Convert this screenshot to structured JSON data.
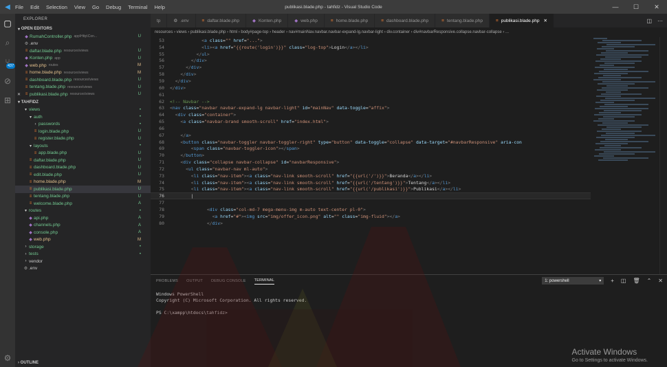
{
  "title_bar": {
    "menu": [
      "File",
      "Edit",
      "Selection",
      "View",
      "Go",
      "Debug",
      "Terminal",
      "Help"
    ],
    "window_title": "publikasi.blade.php - tahfidz - Visual Studio Code"
  },
  "activity_bar": {
    "scm_badge": "437"
  },
  "sidebar": {
    "title": "EXPLORER",
    "open_editors_label": "OPEN EDITORS",
    "open_editors": [
      {
        "name": "RumahController.php",
        "desc": "app\\Http\\Con...",
        "status": "U"
      },
      {
        "name": ".env",
        "desc": "",
        "status": ""
      },
      {
        "name": "daftar.blade.php",
        "desc": "resources\\views",
        "status": "U"
      },
      {
        "name": "Konten.php",
        "desc": "app",
        "status": "U"
      },
      {
        "name": "web.php",
        "desc": "routes",
        "status": "M"
      },
      {
        "name": "home.blade.php",
        "desc": "resources\\views",
        "status": "M"
      },
      {
        "name": "dashboard.blade.php",
        "desc": "resources\\views",
        "status": "U"
      },
      {
        "name": "tentang.blade.php",
        "desc": "resources\\views",
        "status": "U"
      },
      {
        "name": "publikasi.blade.php",
        "desc": "resources\\views",
        "status": "U"
      }
    ],
    "project_label": "TAHFIDZ",
    "tree": [
      {
        "name": "views",
        "indent": 1,
        "kind": "folder-open",
        "status": "•"
      },
      {
        "name": "auth",
        "indent": 2,
        "kind": "folder-open",
        "status": "•"
      },
      {
        "name": "passwords",
        "indent": 3,
        "kind": "folder",
        "status": "•"
      },
      {
        "name": "login.blade.php",
        "indent": 3,
        "kind": "file",
        "status": "U"
      },
      {
        "name": "register.blade.php",
        "indent": 3,
        "kind": "file",
        "status": "U"
      },
      {
        "name": "layouts",
        "indent": 2,
        "kind": "folder-open",
        "status": "•"
      },
      {
        "name": "app.blade.php",
        "indent": 3,
        "kind": "file",
        "status": "U"
      },
      {
        "name": "daftar.blade.php",
        "indent": 2,
        "kind": "file",
        "status": "U"
      },
      {
        "name": "dashboard.blade.php",
        "indent": 2,
        "kind": "file",
        "status": "U"
      },
      {
        "name": "edit.blade.php",
        "indent": 2,
        "kind": "file",
        "status": "U"
      },
      {
        "name": "home.blade.php",
        "indent": 2,
        "kind": "file",
        "status": "M"
      },
      {
        "name": "publikasi.blade.php",
        "indent": 2,
        "kind": "file",
        "status": "U",
        "selected": true
      },
      {
        "name": "tentang.blade.php",
        "indent": 2,
        "kind": "file",
        "status": "U"
      },
      {
        "name": "welcome.blade.php",
        "indent": 2,
        "kind": "file",
        "status": "A"
      },
      {
        "name": "routes",
        "indent": 1,
        "kind": "folder-open",
        "status": "•"
      },
      {
        "name": "api.php",
        "indent": 2,
        "kind": "php",
        "status": "A"
      },
      {
        "name": "channels.php",
        "indent": 2,
        "kind": "php",
        "status": "A"
      },
      {
        "name": "console.php",
        "indent": 2,
        "kind": "php",
        "status": "A"
      },
      {
        "name": "web.php",
        "indent": 2,
        "kind": "php",
        "status": "M"
      },
      {
        "name": "storage",
        "indent": 1,
        "kind": "folder",
        "status": "•"
      },
      {
        "name": "tests",
        "indent": 1,
        "kind": "folder",
        "status": "•"
      },
      {
        "name": "vendor",
        "indent": 1,
        "kind": "folder",
        "status": ""
      },
      {
        "name": ".env",
        "indent": 1,
        "kind": "env",
        "status": ""
      }
    ],
    "outline_label": "OUTLINE"
  },
  "tabs": [
    {
      "name": "tp",
      "icon": "",
      "active": false
    },
    {
      "name": ".env",
      "icon": "env",
      "active": false
    },
    {
      "name": "daftar.blade.php",
      "icon": "blade",
      "active": false
    },
    {
      "name": "Konten.php",
      "icon": "php",
      "active": false
    },
    {
      "name": "web.php",
      "icon": "php",
      "active": false
    },
    {
      "name": "home.blade.php",
      "icon": "blade",
      "active": false
    },
    {
      "name": "dashboard.blade.php",
      "icon": "blade",
      "active": false
    },
    {
      "name": "tentang.blade.php",
      "icon": "blade",
      "active": false
    },
    {
      "name": "publikasi.blade.php",
      "icon": "blade",
      "active": true
    }
  ],
  "breadcrumbs": "resources › views › publikasi.blade.php › html › body#page-top › header › nav#mainNav.navbar.navbar-expand-lg.navbar-light › div.container › div#navbarResponsive.collapse.navbar-collapse › ...",
  "code_lines": [
    {
      "n": "53",
      "html": "            <span class='t-punc'>&lt;</span><span class='t-tag'>a</span> <span class='t-attr'>class</span>=<span class='t-str'>\"\"</span> <span class='t-attr'>href</span>=<span class='t-str'>\"...\"</span><span class='t-punc'>&gt;</span>"
    },
    {
      "n": "54",
      "html": "            <span class='t-punc'>&lt;</span><span class='t-tag'>li</span><span class='t-punc'>&gt;&lt;</span><span class='t-tag'>a</span> <span class='t-attr'>href</span>=<span class='t-str'>\"{{route('login')}}\"</span> <span class='t-attr'>class</span>=<span class='t-str'>\"log-top\"</span><span class='t-punc'>&gt;</span><span class='t-txt'>Login</span><span class='t-punc'>&lt;/</span><span class='t-tag'>a</span><span class='t-punc'>&gt;&lt;/</span><span class='t-tag'>li</span><span class='t-punc'>&gt;</span>"
    },
    {
      "n": "55",
      "html": "          <span class='t-punc'>&lt;/</span><span class='t-tag'>ul</span><span class='t-punc'>&gt;</span>"
    },
    {
      "n": "56",
      "html": "        <span class='t-punc'>&lt;/</span><span class='t-tag'>div</span><span class='t-punc'>&gt;</span>"
    },
    {
      "n": "57",
      "html": "      <span class='t-punc'>&lt;/</span><span class='t-tag'>div</span><span class='t-punc'>&gt;</span>"
    },
    {
      "n": "58",
      "html": "    <span class='t-punc'>&lt;/</span><span class='t-tag'>div</span><span class='t-punc'>&gt;</span>"
    },
    {
      "n": "59",
      "html": "  <span class='t-punc'>&lt;/</span><span class='t-tag'>div</span><span class='t-punc'>&gt;</span>"
    },
    {
      "n": "60",
      "html": "<span class='t-punc'>&lt;/</span><span class='t-tag'>div</span><span class='t-punc'>&gt;</span>"
    },
    {
      "n": "61",
      "html": ""
    },
    {
      "n": "62",
      "html": "<span class='t-cmt'>&lt;!-- Navbar --&gt;</span>"
    },
    {
      "n": "63",
      "html": "<span class='t-punc'>&lt;</span><span class='t-tag'>nav</span> <span class='t-attr'>class</span>=<span class='t-str'>\"navbar navbar-expand-lg navbar-light\"</span> <span class='t-attr'>id</span>=<span class='t-str'>\"mainNav\"</span> <span class='t-attr'>data-toggle</span>=<span class='t-str'>\"affix\"</span><span class='t-punc'>&gt;</span>"
    },
    {
      "n": "64",
      "html": "  <span class='t-punc'>&lt;</span><span class='t-tag'>div</span> <span class='t-attr'>class</span>=<span class='t-str'>\"container\"</span><span class='t-punc'>&gt;</span>"
    },
    {
      "n": "65",
      "html": "    <span class='t-punc'>&lt;</span><span class='t-tag'>a</span> <span class='t-attr'>class</span>=<span class='t-str'>\"navbar-brand smooth-scroll\"</span> <span class='t-attr'>href</span>=<span class='t-str'>\"index.html\"</span><span class='t-punc'>&gt;</span>"
    },
    {
      "n": "66",
      "html": ""
    },
    {
      "n": "67",
      "html": "    <span class='t-punc'>&lt;/</span><span class='t-tag'>a</span><span class='t-punc'>&gt;</span>"
    },
    {
      "n": "68",
      "html": "    <span class='t-punc'>&lt;</span><span class='t-tag'>button</span> <span class='t-attr'>class</span>=<span class='t-str'>\"navbar-toggler navbar-toggler-right\"</span> <span class='t-attr'>type</span>=<span class='t-str'>\"button\"</span> <span class='t-attr'>data-toggle</span>=<span class='t-str'>\"collapse\"</span> <span class='t-attr'>data-target</span>=<span class='t-str'>\"#navbarResponsive\"</span> <span class='t-attr'>aria-con</span>"
    },
    {
      "n": "69",
      "html": "        <span class='t-punc'>&lt;</span><span class='t-tag'>span</span> <span class='t-attr'>class</span>=<span class='t-str'>\"navbar-toggler-icon\"</span><span class='t-punc'>&gt;&lt;/</span><span class='t-tag'>span</span><span class='t-punc'>&gt;</span>"
    },
    {
      "n": "70",
      "html": "    <span class='t-punc'>&lt;/</span><span class='t-tag'>button</span><span class='t-punc'>&gt;</span>"
    },
    {
      "n": "71",
      "html": "    <span class='t-punc'>&lt;</span><span class='t-tag'>div</span> <span class='t-attr'>class</span>=<span class='t-str'>\"collapse navbar-collapse\"</span> <span class='t-attr'>id</span>=<span class='t-str'>\"navbarResponsive\"</span><span class='t-punc'>&gt;</span>"
    },
    {
      "n": "72",
      "html": "      <span class='t-punc'>&lt;</span><span class='t-tag'>ul</span> <span class='t-attr'>class</span>=<span class='t-str'>\"navbar-nav ml-auto\"</span><span class='t-punc'>&gt;</span>"
    },
    {
      "n": "73",
      "html": "        <span class='t-punc'>&lt;</span><span class='t-tag'>li</span> <span class='t-attr'>class</span>=<span class='t-str'>\"nav-item\"</span><span class='t-punc'>&gt;&lt;</span><span class='t-tag'>a</span> <span class='t-attr'>class</span>=<span class='t-str'>\"nav-link smooth-scroll\"</span> <span class='t-attr'>href</span>=<span class='t-str'>\"{{url('/')}}\"</span><span class='t-punc'>&gt;</span><span class='t-txt'>Beranda</span><span class='t-punc'>&lt;/</span><span class='t-tag'>a</span><span class='t-punc'>&gt;&lt;/</span><span class='t-tag'>li</span><span class='t-punc'>&gt;</span>"
    },
    {
      "n": "74",
      "html": "        <span class='t-punc'>&lt;</span><span class='t-tag'>li</span> <span class='t-attr'>class</span>=<span class='t-str'>\"nav-item\"</span><span class='t-punc'>&gt;&lt;</span><span class='t-tag'>a</span> <span class='t-attr'>class</span>=<span class='t-str'>\"nav-link smooth-scroll\"</span> <span class='t-attr'>href</span>=<span class='t-str'>\"{{url('/tentang')}}\"</span><span class='t-punc'>&gt;</span><span class='t-txt'>Tentang</span><span class='t-punc'>&lt;/</span><span class='t-tag'>a</span><span class='t-punc'>&gt;&lt;/</span><span class='t-tag'>li</span><span class='t-punc'>&gt;</span>"
    },
    {
      "n": "75",
      "html": "        <span class='t-punc'>&lt;</span><span class='t-tag'>li</span> <span class='t-attr'>class</span>=<span class='t-str'>\"nav-item\"</span><span class='t-punc'>&gt;&lt;</span><span class='t-tag'>a</span> <span class='t-attr'>class</span>=<span class='t-str'>\"nav-link smooth-scroll\"</span> <span class='t-attr'>href</span>=<span class='t-str'>\"{{url('/publikasi')}}\"</span><span class='t-punc'>&gt;</span><span class='t-txt'>Publikasi</span><span class='t-punc'>&lt;/</span><span class='t-tag'>a</span><span class='t-punc'>&gt;&lt;/</span><span class='t-tag'>li</span><span class='t-punc'>&gt;</span>"
    },
    {
      "n": "76",
      "html": "        |",
      "current": true
    },
    {
      "n": "77",
      "html": ""
    },
    {
      "n": "78",
      "html": "              <span class='t-punc'>&lt;</span><span class='t-tag'>div</span> <span class='t-attr'>class</span>=<span class='t-str'>\"col-md-7 mega-menu-img m-auto text-center pl-0\"</span><span class='t-punc'>&gt;</span>"
    },
    {
      "n": "79",
      "html": "                <span class='t-punc'>&lt;</span><span class='t-tag'>a</span> <span class='t-attr'>href</span>=<span class='t-str'>\"#\"</span><span class='t-punc'>&gt;&lt;</span><span class='t-tag'>img</span> <span class='t-attr'>src</span>=<span class='t-str'>\"img/offer_icon.png\"</span> <span class='t-attr'>alt</span>=<span class='t-str'>\"\"</span> <span class='t-attr'>class</span>=<span class='t-str'>\"img-fluid\"</span><span class='t-punc'>&gt;&lt;/</span><span class='t-tag'>a</span><span class='t-punc'>&gt;</span>"
    },
    {
      "n": "80",
      "html": "              <span class='t-punc'>&lt;/</span><span class='t-tag'>div</span><span class='t-punc'>&gt;</span>"
    }
  ],
  "panel": {
    "tabs": [
      "PROBLEMS",
      "OUTPUT",
      "DEBUG CONSOLE",
      "TERMINAL"
    ],
    "active_tab": "TERMINAL",
    "terminal_select": "1: powershell",
    "terminal_lines": [
      "Windows PowerShell",
      "Copyright (C) Microsoft Corporation. All rights reserved.",
      "",
      "PS C:\\xampp\\htdocs\\tahfidz>"
    ]
  },
  "activation": {
    "title": "Activate Windows",
    "subtitle": "Go to Settings to activate Windows."
  },
  "colors": {
    "accent": "#007acc",
    "untracked": "#73c991",
    "modified": "#e2c08d",
    "watermark_red": "#8b1a1a"
  }
}
